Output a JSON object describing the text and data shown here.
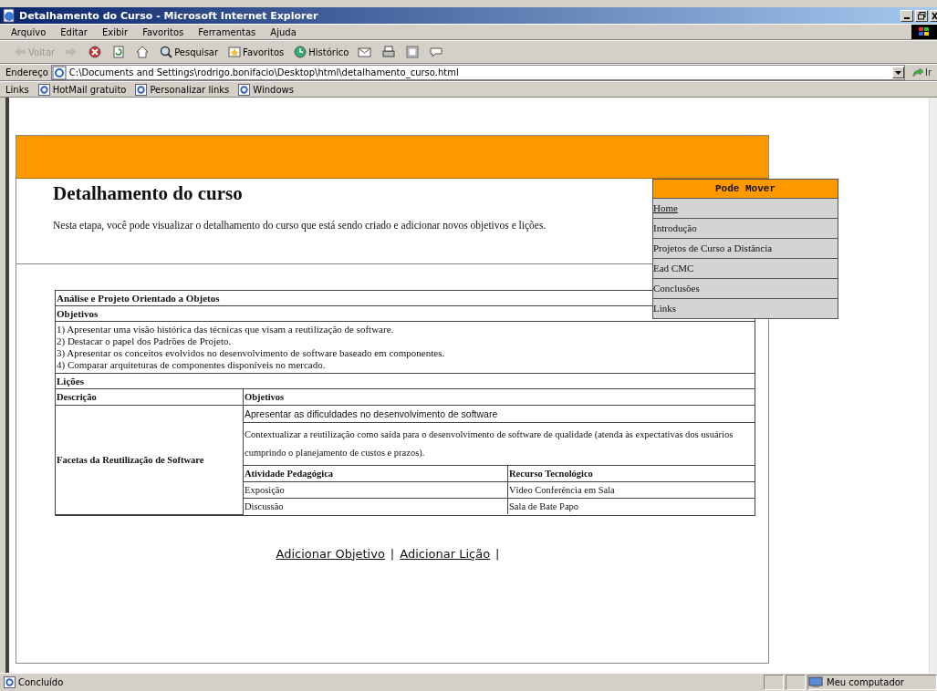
{
  "window": {
    "title": "Detalhamento do Curso - Microsoft Internet Explorer"
  },
  "menu_bar": [
    "Arquivo",
    "Editar",
    "Exibir",
    "Favoritos",
    "Ferramentas",
    "Ajuda"
  ],
  "toolbar": [
    {
      "kind": "back",
      "label": "Voltar",
      "disabled": true
    },
    {
      "kind": "forward",
      "disabled": true
    },
    {
      "kind": "stop",
      "disabled": false
    },
    {
      "kind": "refresh",
      "disabled": false
    },
    {
      "kind": "home",
      "disabled": false
    },
    {
      "kind": "search",
      "label": "Pesquisar",
      "disabled": false
    },
    {
      "kind": "favorites",
      "label": "Favoritos",
      "disabled": false
    },
    {
      "kind": "history",
      "label": "Histórico",
      "disabled": false
    },
    {
      "kind": "mail",
      "disabled": false
    },
    {
      "kind": "print",
      "disabled": false
    },
    {
      "kind": "edit",
      "disabled": false
    },
    {
      "kind": "discuss",
      "disabled": false
    }
  ],
  "address_bar": {
    "label": "Endereço",
    "value": "C:\\Documents and Settings\\rodrigo.bonifacio\\Desktop\\html\\detalhamento_curso.html",
    "go_label": "Ir"
  },
  "links_bar": {
    "label": "Links",
    "items": [
      "HotMail gratuito",
      "Personalizar links",
      "Windows"
    ]
  },
  "page": {
    "heading": "Detalhamento do curso",
    "intro": "Nesta etapa, você pode visualizar o detalhamento do curso que está sendo criado e adicionar novos objetivos e lições.",
    "course": {
      "title": "Análise e Projeto Orientado a Objetos",
      "objectives_heading": "Objetivos",
      "objectives": [
        "1) Apresentar uma visão histórica das técnicas que visam a reutilização de software.",
        "2) Destacar o papel dos Padrões de Projeto.",
        "3) Apresentar os conceitos evolvidos no desenvolvimento de software baseado em componentes.",
        "4) Comparar arquiteturas de componentes disponíveis no mercado."
      ],
      "lessons_heading": "Lições",
      "lesson_columns": [
        "Descrição",
        "Objetivos"
      ],
      "lessons": [
        {
          "description": "Facetas da Reutilização de Software",
          "objectives": [
            "Apresentar as dificuldades no desenvolvimento de software",
            "Contextualizar a reutilização como saída para o desenvolvimento de software de qualidade (atenda às expectativas dos usuários cumprindo o planejamento de custos e prazos)."
          ],
          "activity_columns": [
            "Atividade Pedagógica",
            "Recurso Tecnológico"
          ],
          "activities": [
            [
              "Exposição",
              "Vídeo Conferência em Sala"
            ],
            [
              "Discussão",
              "Sala de Bate Papo"
            ]
          ]
        }
      ]
    },
    "actions": [
      "Adicionar Objetivo",
      "Adicionar Lição"
    ],
    "separator": "|"
  },
  "float_menu": {
    "title": "Pode Mover",
    "items": [
      {
        "label": "Home",
        "hovered": true
      },
      {
        "label": "Introdução",
        "hovered": false
      },
      {
        "label": "Projetos de Curso a Distância",
        "hovered": false
      },
      {
        "label": "Ead CMC",
        "hovered": false
      },
      {
        "label": "Conclusões",
        "hovered": false
      },
      {
        "label": "Links",
        "hovered": false
      }
    ]
  },
  "status_bar": {
    "text": "Concluído",
    "zone": "Meu computador"
  }
}
